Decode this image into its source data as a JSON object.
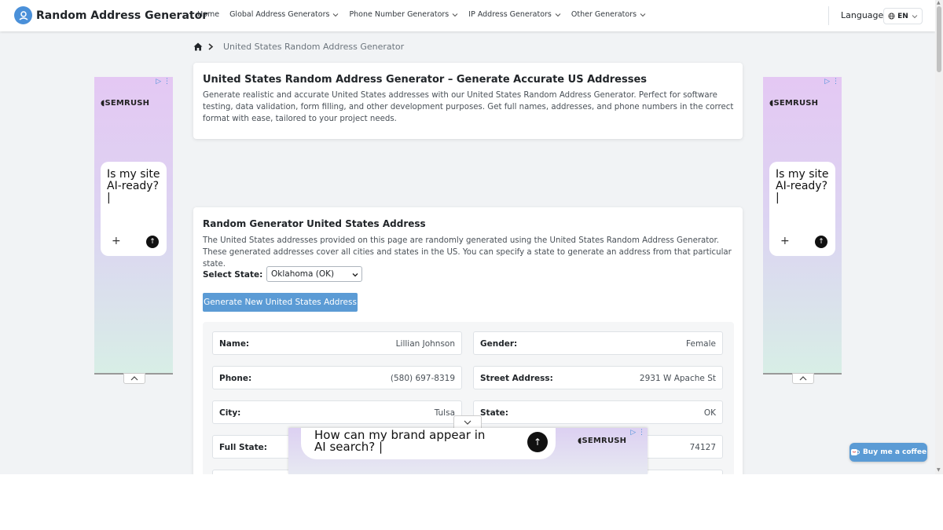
{
  "navbar": {
    "brand": "Random Address Generator",
    "items": [
      {
        "label": "Home",
        "dropdown": false
      },
      {
        "label": "Global Address Generators",
        "dropdown": true
      },
      {
        "label": "Phone Number Generators",
        "dropdown": true
      },
      {
        "label": "IP Address Generators",
        "dropdown": true
      },
      {
        "label": "Other Generators",
        "dropdown": true
      }
    ],
    "language_label": "Language",
    "language_value": "EN"
  },
  "breadcrumb": {
    "current": "United States Random Address Generator"
  },
  "intro_card": {
    "title": "United States Random Address Generator – Generate Accurate US Addresses",
    "description": "Generate realistic and accurate United States addresses with our United States Random Address Generator. Perfect for software testing, data validation, form filling, and other development purposes. Get full names, addresses, and phone numbers in the correct format with ease, tailored to your project needs."
  },
  "generator_card": {
    "title": "Random Generator United States Address",
    "description": "The United States addresses provided on this page are randomly generated using the United States Random Address Generator. These generated addresses cover all cities and states in the US. You can specify a state to generate an address from that particular state.",
    "state_label": "Select State:",
    "state_value": "Oklahoma (OK)",
    "generate_button": "Generate New United States Address",
    "fields": {
      "name": {
        "label": "Name:",
        "value": "Lillian Johnson"
      },
      "gender": {
        "label": "Gender:",
        "value": "Female"
      },
      "phone": {
        "label": "Phone:",
        "value": "(580) 697-8319"
      },
      "street": {
        "label": "Street Address:",
        "value": "2931 W Apache St"
      },
      "city": {
        "label": "City:",
        "value": "Tulsa"
      },
      "state": {
        "label": "State:",
        "value": "OK"
      },
      "full_state": {
        "label": "Full State:",
        "value": ""
      },
      "zip": {
        "label": "",
        "value": "74127"
      }
    }
  },
  "ads": {
    "side_brand": "SEMRUSH",
    "side_text": "Is my site AI-ready? |",
    "bottom_brand": "SEMRUSH",
    "bottom_text": "How can my brand appear in AI search? |"
  },
  "coffee_button": "Buy me a coffee",
  "colors": {
    "accent": "#5b9bd5",
    "page_bg": "#f1f3f5"
  }
}
